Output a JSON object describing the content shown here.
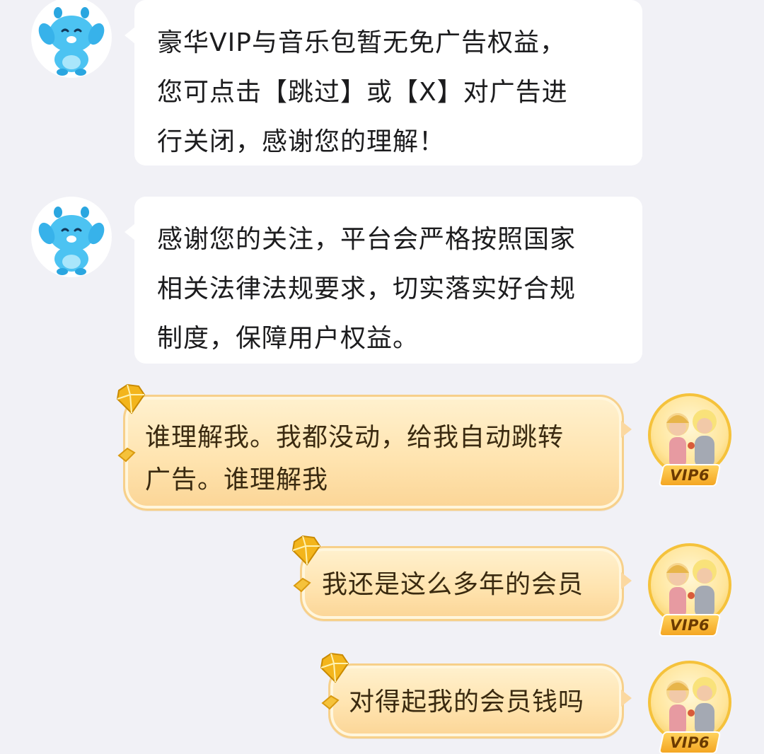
{
  "messages": [
    {
      "direction": "incoming",
      "sender_avatar": "blue-mascot-avatar",
      "lines": [
        "豪华VIP与音乐包暂无免广告权益，",
        "您可点击【跳过】或【X】对广告进",
        "行关闭，感谢您的理解！"
      ]
    },
    {
      "direction": "incoming",
      "sender_avatar": "blue-mascot-avatar",
      "lines": [
        "感谢您的关注，平台会严格按照国家",
        "相关法律法规要求，切实落实好合规",
        "制度，保障用户权益。"
      ]
    },
    {
      "direction": "outgoing",
      "lines": [
        "谁理解我。我都没动，给我自动跳转",
        "广告。谁理解我"
      ],
      "vip_badge": "VIP6"
    },
    {
      "direction": "outgoing",
      "lines": [
        "我还是这么多年的会员"
      ],
      "vip_badge": "VIP6"
    },
    {
      "direction": "outgoing",
      "lines": [
        "对得起我的会员钱吗"
      ],
      "vip_badge": "VIP6"
    }
  ],
  "colors": {
    "background": "#f1f1f6",
    "incoming_bubble": "#ffffff",
    "outgoing_bubble": "#ffe4b0",
    "vip_badge": "#f4a623"
  },
  "icons": {
    "bot_avatar": "blue-mascot-icon",
    "user_avatar": "couple-figurine-icon",
    "bubble_decoration": "gold-gem-icon"
  }
}
